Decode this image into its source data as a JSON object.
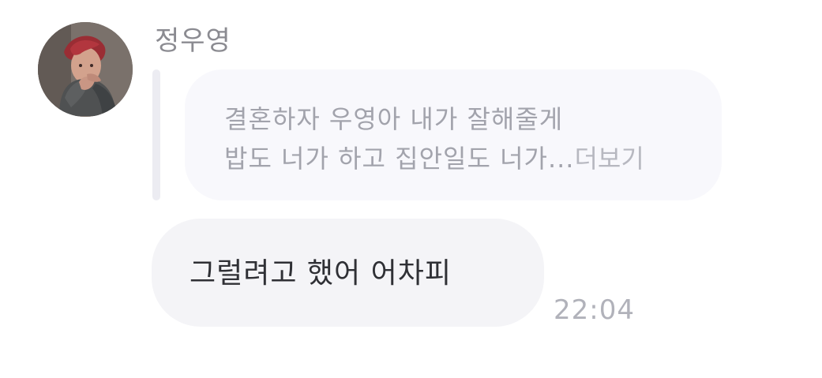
{
  "message": {
    "sender_name": "정우영",
    "avatar_icon": "profile-photo",
    "quote": {
      "line1": "결혼하자 우영아 내가 잘해줄게",
      "line2": "밥도 너가 하고 집안일도 너가...",
      "more_label": "더보기"
    },
    "reply_text": "그럴려고 했어 어차피",
    "time": "22:04"
  }
}
